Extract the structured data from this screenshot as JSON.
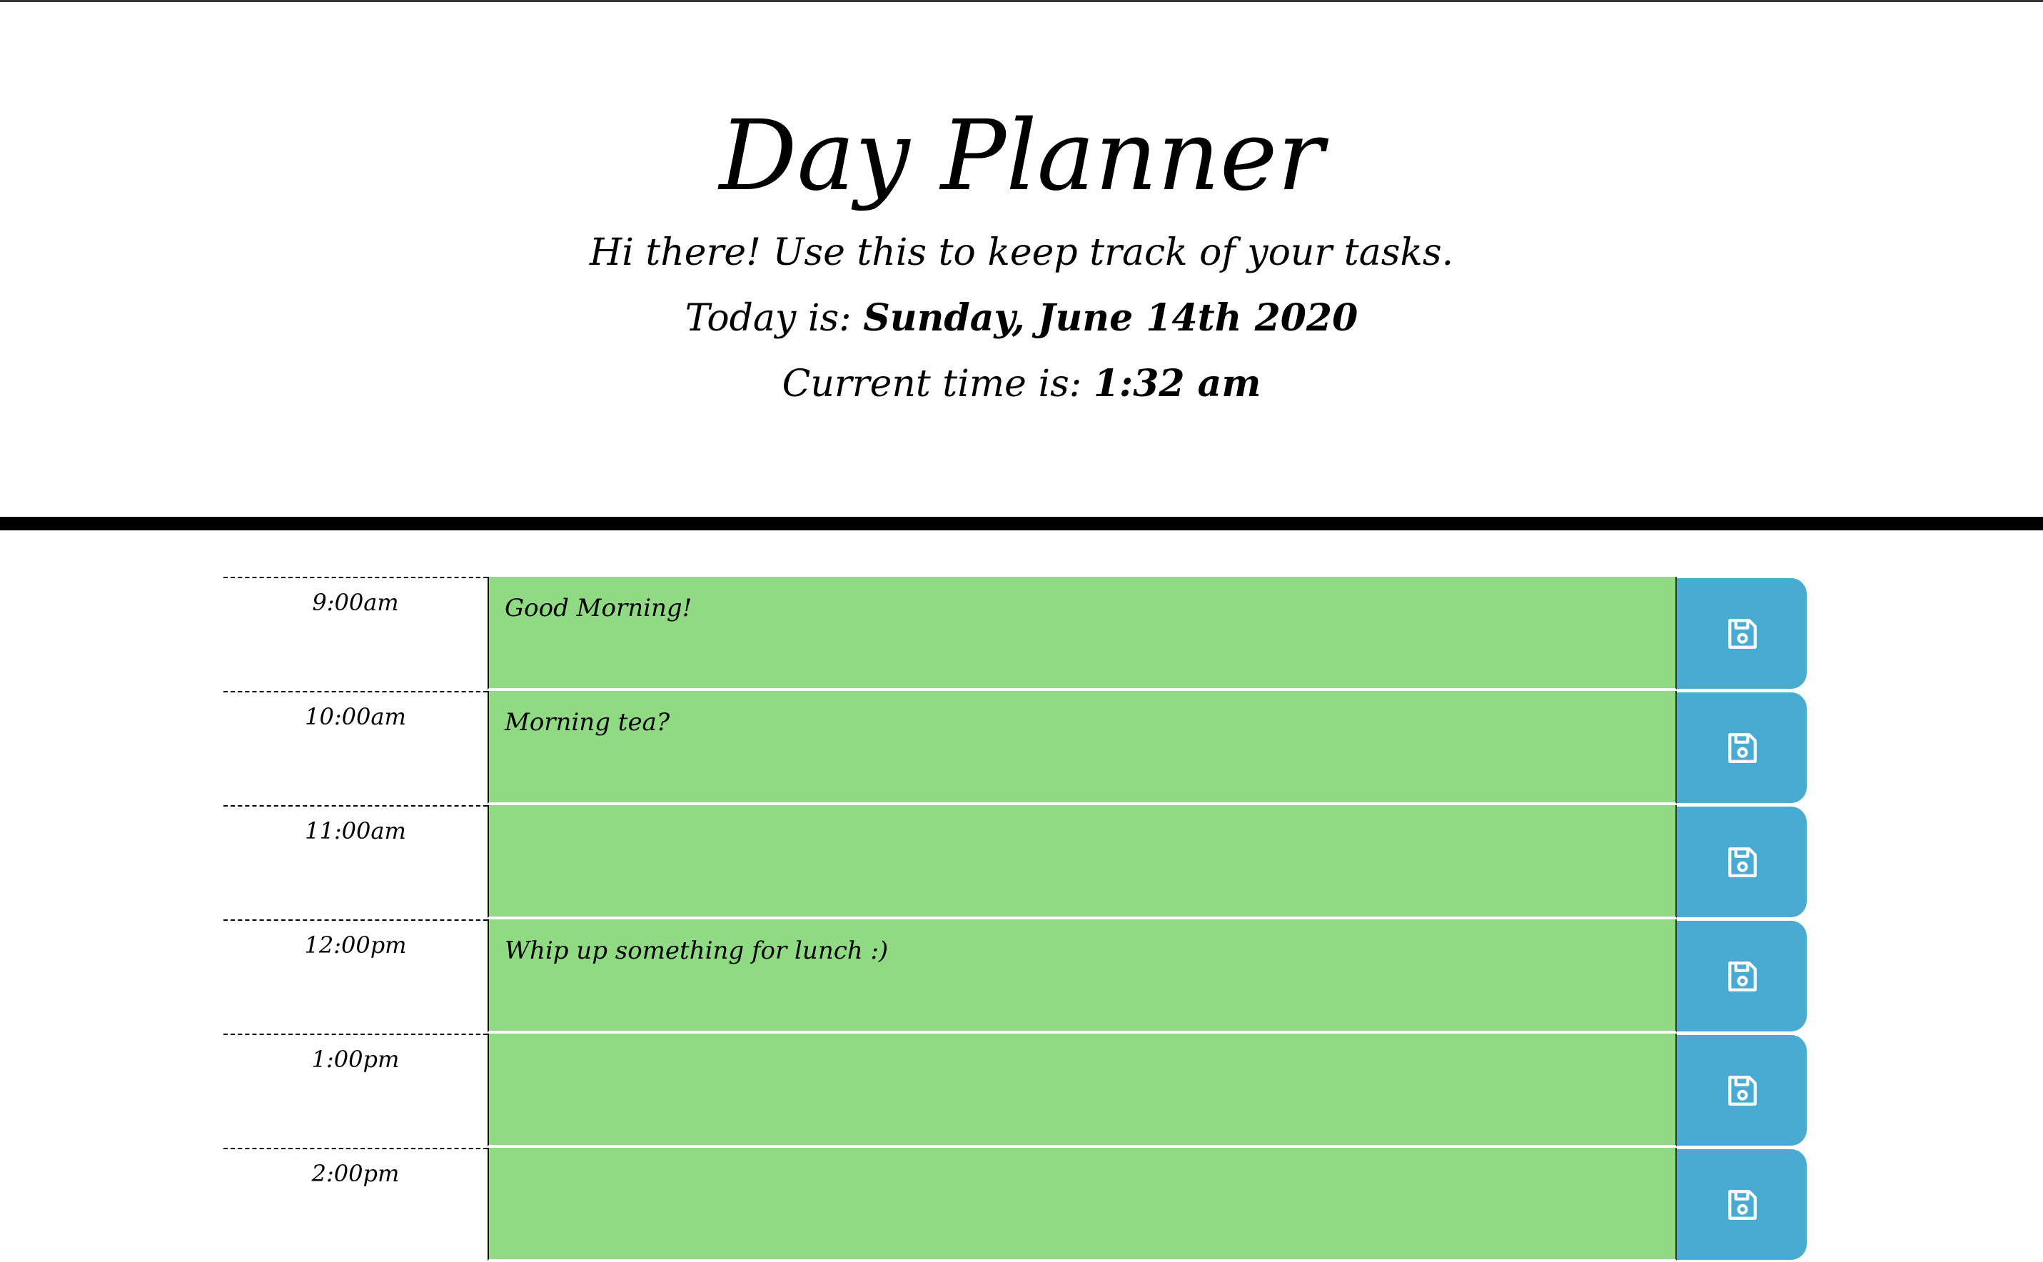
{
  "header": {
    "title": "Day Planner",
    "subtitle": "Hi there! Use this to keep track of your tasks.",
    "today_label": "Today is:",
    "today_value": "Sunday, June 14th 2020",
    "time_label": "Current time is:",
    "time_value": "1:32 am"
  },
  "colors": {
    "present_task_bg": "#91da84",
    "save_button_bg": "#4aabd2"
  },
  "rows": [
    {
      "hour": "9:00am",
      "task": "Good Morning!",
      "save_icon": "save-icon"
    },
    {
      "hour": "10:00am",
      "task": "Morning tea?",
      "save_icon": "save-icon"
    },
    {
      "hour": "11:00am",
      "task": "",
      "save_icon": "save-icon"
    },
    {
      "hour": "12:00pm",
      "task": "Whip up something for lunch :)",
      "save_icon": "save-icon"
    },
    {
      "hour": "1:00pm",
      "task": "",
      "save_icon": "save-icon"
    },
    {
      "hour": "2:00pm",
      "task": "",
      "save_icon": "save-icon"
    }
  ]
}
